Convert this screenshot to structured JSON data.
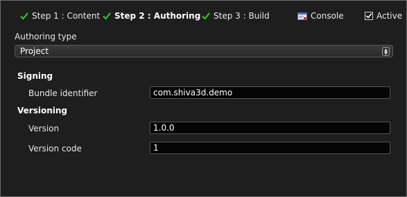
{
  "tabs": [
    {
      "label": "Step 1 : Content"
    },
    {
      "label": "Step 2 : Authoring"
    },
    {
      "label": "Step 3 : Build"
    }
  ],
  "console": {
    "label": "Console"
  },
  "active": {
    "label": "Active",
    "checked": true
  },
  "authoring": {
    "label": "Authoring type",
    "selected": "Project"
  },
  "signing": {
    "title": "Signing",
    "bundle_label": "Bundle identifier",
    "bundle_value": "com.shiva3d.demo"
  },
  "versioning": {
    "title": "Versioning",
    "version_label": "Version",
    "version_value": "1.0.0",
    "code_label": "Version code",
    "code_value": "1"
  },
  "colors": {
    "check_green": "#2fd12f",
    "background": "#1e1e1e",
    "field_bg": "#050505"
  }
}
